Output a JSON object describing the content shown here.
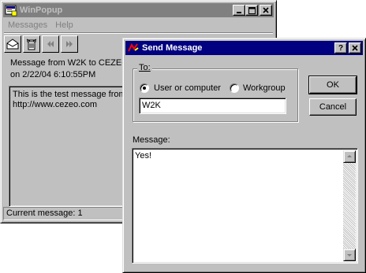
{
  "winpopup": {
    "title": "WinPopup",
    "menu": {
      "messages": "Messages",
      "help": "Help"
    },
    "toolbar": [
      "envelope-icon",
      "trash-icon",
      "previous-icon",
      "next-icon"
    ],
    "header_line1": "Message from W2K to CEZEO",
    "header_line2": "on 2/22/04 6:10:55PM",
    "body_line1": "This is the test message from",
    "body_line2": "http://www.cezeo.com",
    "status": "Current message: 1"
  },
  "send_message": {
    "title": "Send Message",
    "to_label": "To:",
    "radio_user": "User or computer",
    "radio_workgroup": "Workgroup",
    "to_value": "W2K",
    "message_label": "Message:",
    "message_value": "Yes!",
    "ok": "OK",
    "cancel": "Cancel"
  },
  "colors": {
    "active_title": "#000080",
    "inactive_title": "#808080",
    "face": "#c0c0c0"
  }
}
